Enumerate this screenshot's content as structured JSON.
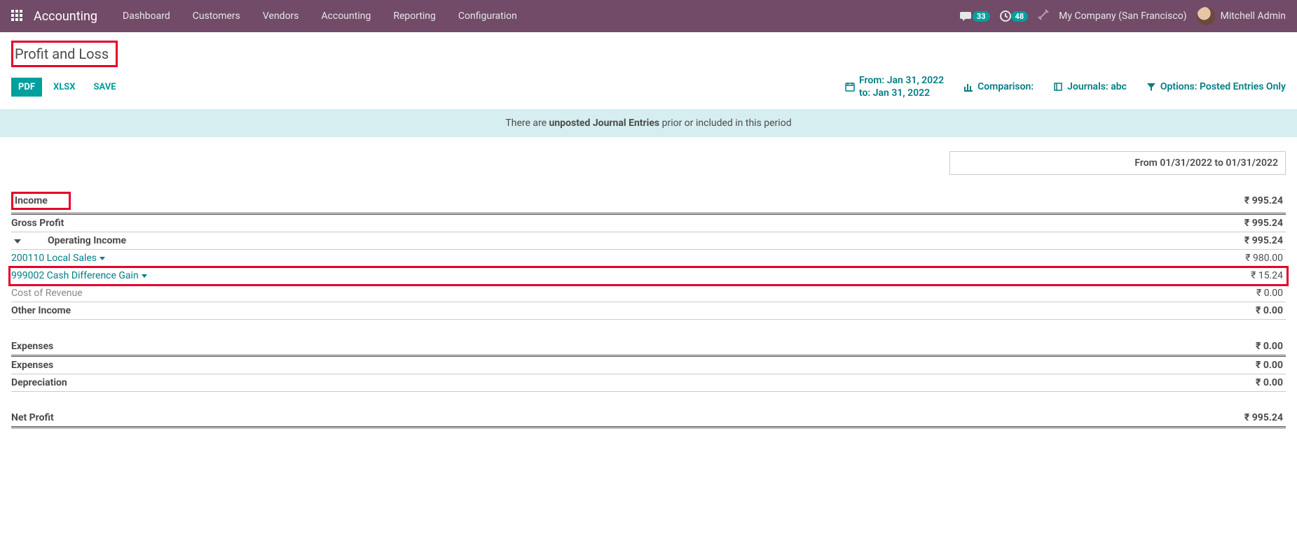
{
  "nav": {
    "brand": "Accounting",
    "items": [
      "Dashboard",
      "Customers",
      "Vendors",
      "Accounting",
      "Reporting",
      "Configuration"
    ],
    "msg_count": "33",
    "activity_count": "48",
    "company": "My Company (San Francisco)",
    "user": "Mitchell Admin"
  },
  "page": {
    "title": "Profit and Loss"
  },
  "buttons": {
    "pdf": "PDF",
    "xlsx": "XLSX",
    "save": "SAVE"
  },
  "filters": {
    "date_label": "From: Jan 31, 2022\nto: Jan 31, 2022",
    "comparison": "Comparison:",
    "journals": "Journals: abc",
    "options": "Options: Posted Entries Only"
  },
  "notice": {
    "pre": "There are ",
    "strong": "unposted Journal Entries",
    "post": " prior or included in this period"
  },
  "report": {
    "date_range": "From 01/31/2022 to 01/31/2022",
    "rows": {
      "income": {
        "label": "Income",
        "amount": "₹ 995.24"
      },
      "gross_profit": {
        "label": "Gross Profit",
        "amount": "₹ 995.24"
      },
      "operating_income": {
        "label": "Operating Income",
        "amount": "₹ 995.24"
      },
      "local_sales": {
        "label": "200110 Local Sales",
        "amount": "₹ 980.00"
      },
      "cash_diff_gain": {
        "label": "999002 Cash Difference Gain",
        "amount": "₹ 15.24"
      },
      "cost_of_revenue": {
        "label": "Cost of Revenue",
        "amount": "₹ 0.00"
      },
      "other_income": {
        "label": "Other Income",
        "amount": "₹ 0.00"
      },
      "expenses": {
        "label": "Expenses",
        "amount": "₹ 0.00"
      },
      "expenses_sub": {
        "label": "Expenses",
        "amount": "₹ 0.00"
      },
      "depreciation": {
        "label": "Depreciation",
        "amount": "₹ 0.00"
      },
      "net_profit": {
        "label": "Net Profit",
        "amount": "₹ 995.24"
      }
    }
  }
}
